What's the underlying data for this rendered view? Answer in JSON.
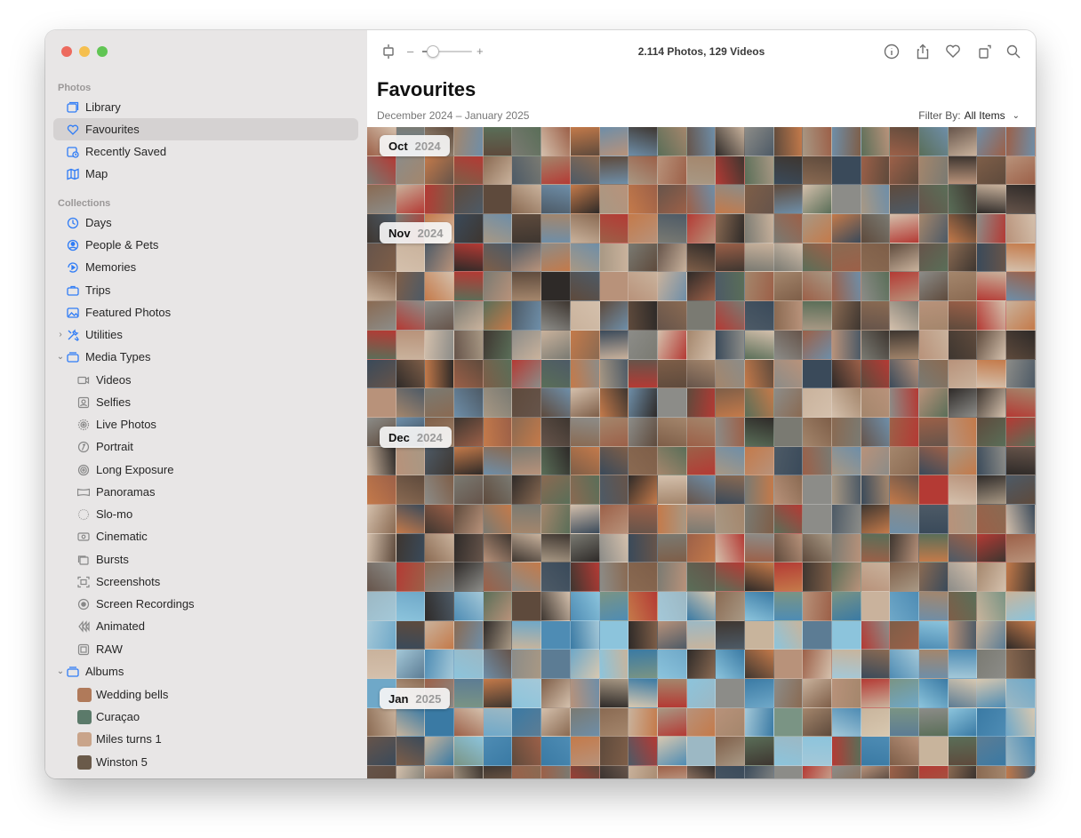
{
  "sidebar": {
    "photos_heading": "Photos",
    "collections_heading": "Collections",
    "top_items": [
      {
        "label": "Library",
        "icon": "library-icon"
      },
      {
        "label": "Favourites",
        "icon": "heart-icon",
        "selected": true
      },
      {
        "label": "Recently Saved",
        "icon": "recently-saved-icon"
      },
      {
        "label": "Map",
        "icon": "map-icon"
      }
    ],
    "collections": [
      {
        "label": "Days",
        "icon": "clock-icon"
      },
      {
        "label": "People & Pets",
        "icon": "person-circle-icon"
      },
      {
        "label": "Memories",
        "icon": "memories-icon"
      },
      {
        "label": "Trips",
        "icon": "suitcase-icon"
      },
      {
        "label": "Featured Photos",
        "icon": "featured-photos-icon"
      },
      {
        "label": "Utilities",
        "icon": "tools-icon",
        "expanded": false
      },
      {
        "label": "Media Types",
        "icon": "stack-icon",
        "expanded": true
      }
    ],
    "media_types": [
      {
        "label": "Videos",
        "icon": "video-icon"
      },
      {
        "label": "Selfies",
        "icon": "selfie-icon"
      },
      {
        "label": "Live Photos",
        "icon": "live-photo-icon"
      },
      {
        "label": "Portrait",
        "icon": "portrait-icon"
      },
      {
        "label": "Long Exposure",
        "icon": "long-exposure-icon"
      },
      {
        "label": "Panoramas",
        "icon": "panorama-icon"
      },
      {
        "label": "Slo-mo",
        "icon": "slo-mo-icon"
      },
      {
        "label": "Cinematic",
        "icon": "cinematic-icon"
      },
      {
        "label": "Bursts",
        "icon": "bursts-icon"
      },
      {
        "label": "Screenshots",
        "icon": "screenshot-icon"
      },
      {
        "label": "Screen Recordings",
        "icon": "screen-recording-icon"
      },
      {
        "label": "Animated",
        "icon": "animated-icon"
      },
      {
        "label": "RAW",
        "icon": "raw-icon"
      }
    ],
    "albums_label": "Albums",
    "albums": [
      {
        "label": "Wedding bells",
        "color": "#b07a5a"
      },
      {
        "label": "Curaçao",
        "color": "#5b7a6a"
      },
      {
        "label": "Miles turns 1",
        "color": "#c9a48a"
      },
      {
        "label": "Winston 5",
        "color": "#6a5a4a"
      }
    ]
  },
  "toolbar": {
    "zoom_minus": "–",
    "zoom_plus": "+",
    "zoom_level": 0.2,
    "count": "2.114 Photos, 129 Videos"
  },
  "main": {
    "title": "Favourites",
    "date_range": "December 2024 – January 2025",
    "filter_label": "Filter By:",
    "filter_value": "All Items"
  },
  "months": [
    {
      "month": "Oct",
      "year": "2024"
    },
    {
      "month": "Nov",
      "year": "2024"
    },
    {
      "month": "Dec",
      "year": "2024"
    },
    {
      "month": "Jan",
      "year": "2025"
    }
  ],
  "palette": [
    "#8a6a52",
    "#5e4a3c",
    "#b8927a",
    "#3e3630",
    "#7a7a72",
    "#a4866c",
    "#c9b29c",
    "#4d5a66",
    "#6e8ea8",
    "#9c6048",
    "#2e2a28",
    "#d4c0ac",
    "#7e5e48",
    "#5a6e58",
    "#b43a34",
    "#8c8c88",
    "#3a4a5a",
    "#a89884",
    "#c47a4a",
    "#66544a"
  ],
  "palette_beach": [
    "#6fa8c8",
    "#8cc4dc",
    "#4e8cb4",
    "#c8b49c",
    "#a4c8d8",
    "#5c7c94",
    "#d8c8b0",
    "#3a7aa4",
    "#9cb8c4",
    "#7a9484"
  ]
}
